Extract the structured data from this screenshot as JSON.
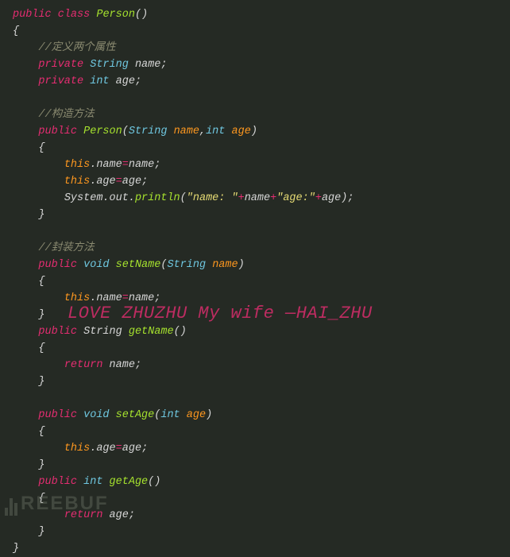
{
  "code": {
    "l1": {
      "kw1": "public",
      "kw2": "class",
      "fn": "Person",
      "p": "()"
    },
    "l2": {
      "p": "{"
    },
    "l3": {
      "indent": "    ",
      "com": "//定义两个属性"
    },
    "l4": {
      "indent": "    ",
      "kw": "private",
      "type": "String",
      "id": "name",
      "sc": ";"
    },
    "l5": {
      "indent": "    ",
      "kw": "private",
      "type": "int",
      "id": "age",
      "sc": ";"
    },
    "l6": {
      "blank": " "
    },
    "l7": {
      "indent": "    ",
      "com": "//构造方法"
    },
    "l8": {
      "indent": "    ",
      "kw": "public",
      "fn": "Person",
      "po": "(",
      "t1": "String",
      "n1": "name",
      "pc": ",",
      "t2": "int",
      "n2": "age",
      "pe": ")"
    },
    "l9": {
      "indent": "    ",
      "p": "{"
    },
    "l10": {
      "indent": "        ",
      "this": "this",
      "dot": ".",
      "lhs": "name",
      "eq": "=",
      "rhs": "name",
      "sc": ";"
    },
    "l11": {
      "indent": "        ",
      "this": "this",
      "dot": ".",
      "lhs": "age",
      "eq": "=",
      "rhs": "age",
      "sc": ";"
    },
    "l12": {
      "indent": "        ",
      "a": "System",
      "d1": ".",
      "b": "out",
      "d2": ".",
      "c": "println",
      "po": "(",
      "s1": "\"name: \"",
      "p1": "+",
      "v1": "name",
      "p2": "+",
      "s2": "\"age:\"",
      "p3": "+",
      "v2": "age",
      "pe": ")",
      "sc": ";"
    },
    "l13": {
      "indent": "    ",
      "p": "}"
    },
    "l14": {
      "blank": " "
    },
    "l15": {
      "indent": "    ",
      "com": "//封装方法"
    },
    "l16": {
      "indent": "    ",
      "kw": "public",
      "type": "void",
      "fn": "setName",
      "po": "(",
      "t1": "String",
      "n1": "name",
      "pe": ")"
    },
    "l17": {
      "indent": "    ",
      "p": "{"
    },
    "l18": {
      "indent": "        ",
      "this": "this",
      "dot": ".",
      "lhs": "name",
      "eq": "=",
      "rhs": "name",
      "sc": ";"
    },
    "l19": {
      "indent": "    ",
      "p": "}"
    },
    "l20": {
      "indent": "    ",
      "kw": "public",
      "type": "String",
      "fn": "getName",
      "po": "(",
      "pe": ")"
    },
    "l21": {
      "indent": "    ",
      "p": "{"
    },
    "l22": {
      "indent": "        ",
      "kw": "return",
      "id": "name",
      "sc": ";"
    },
    "l23": {
      "indent": "    ",
      "p": "}"
    },
    "l24": {
      "blank": " "
    },
    "l25": {
      "indent": "    ",
      "kw": "public",
      "type": "void",
      "fn": "setAge",
      "po": "(",
      "t1": "int",
      "n1": "age",
      "pe": ")"
    },
    "l26": {
      "indent": "    ",
      "p": "{"
    },
    "l27": {
      "indent": "        ",
      "this": "this",
      "dot": ".",
      "lhs": "age",
      "eq": "=",
      "rhs": "age",
      "sc": ";"
    },
    "l28": {
      "indent": "    ",
      "p": "}"
    },
    "l29": {
      "indent": "    ",
      "kw": "public",
      "type": "int",
      "fn": "getAge",
      "po": "(",
      "pe": ")"
    },
    "l30": {
      "indent": "    ",
      "p": "{"
    },
    "l31": {
      "indent": "        ",
      "kw": "return",
      "id": "age",
      "sc": ";"
    },
    "l32": {
      "indent": "    ",
      "p": "}"
    },
    "l33": {
      "p": "}"
    }
  },
  "overlay_text": "LOVE ZHUZHU My wife —HAI_ZHU",
  "watermark": "REEBUF"
}
